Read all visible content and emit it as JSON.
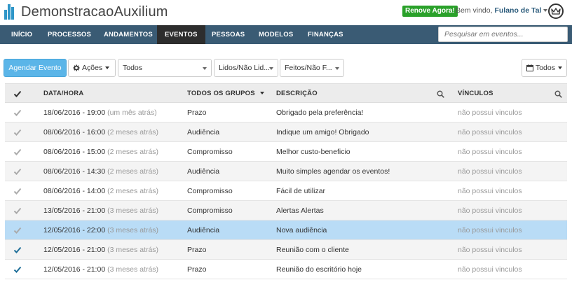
{
  "app": {
    "title": "DemonstracaoAuxilium",
    "renew_label": "Renove Agora!",
    "welcome_prefix": "Bem vindo,",
    "user_name": "Fulano de Tal",
    "brand_color": "#2f96c8",
    "nav_color": "#3a5b74"
  },
  "nav": {
    "items": [
      {
        "label": "INÍCIO"
      },
      {
        "label": "PROCESSOS"
      },
      {
        "label": "ANDAMENTOS"
      },
      {
        "label": "EVENTOS"
      },
      {
        "label": "PESSOAS"
      },
      {
        "label": "MODELOS"
      },
      {
        "label": "FINANÇAS"
      }
    ],
    "active_index": 3,
    "search_placeholder": "Pesquisar em eventos..."
  },
  "toolbar": {
    "schedule_label": "Agendar Evento",
    "actions_label": "Ações",
    "filter_all": "Todos",
    "filter_read": "Lidos/Não Lid...",
    "filter_done": "Feitos/Não F...",
    "calendar_filter": "Todos"
  },
  "table": {
    "headers": {
      "datetime": "DATA/HORA",
      "groups": "TODOS OS GRUPOS",
      "description": "DESCRIÇÃO",
      "links": "VÍNCULOS"
    },
    "rows": [
      {
        "date": "18/06/2016 - 19:00",
        "rel": "(um mês atrás)",
        "group": "Prazo",
        "desc": "Obrigado pela preferência!",
        "links": "não possui vinculos",
        "done": false
      },
      {
        "date": "08/06/2016 - 16:00",
        "rel": "(2 meses atrás)",
        "group": "Audiência",
        "desc": "Indique um amigo! Obrigado",
        "links": "não possui vinculos",
        "done": false
      },
      {
        "date": "08/06/2016 - 15:00",
        "rel": "(2 meses atrás)",
        "group": "Compromisso",
        "desc": "Melhor custo-beneficio",
        "links": "não possui vinculos",
        "done": false
      },
      {
        "date": "08/06/2016 - 14:30",
        "rel": "(2 meses atrás)",
        "group": "Audiência",
        "desc": "Muito simples agendar os eventos!",
        "links": "não possui vinculos",
        "done": false
      },
      {
        "date": "08/06/2016 - 14:00",
        "rel": "(2 meses atrás)",
        "group": "Compromisso",
        "desc": "Fácil de utilizar",
        "links": "não possui vinculos",
        "done": false
      },
      {
        "date": "13/05/2016 - 21:00",
        "rel": "(3 meses atrás)",
        "group": "Compromisso",
        "desc": "Alertas Alertas",
        "links": "não possui vinculos",
        "done": false
      },
      {
        "date": "12/05/2016 - 22:00",
        "rel": "(3 meses atrás)",
        "group": "Audiência",
        "desc": "Nova audiência",
        "links": "não possui vinculos",
        "done": false,
        "selected": true
      },
      {
        "date": "12/05/2016 - 21:00",
        "rel": "(3 meses atrás)",
        "group": "Prazo",
        "desc": "Reunião com o cliente",
        "links": "não possui vinculos",
        "done": true
      },
      {
        "date": "12/05/2016 - 21:00",
        "rel": "(3 meses atrás)",
        "group": "Prazo",
        "desc": "Reunião do escritório hoje",
        "links": "não possui vinculos",
        "done": true
      }
    ],
    "colors": {
      "check_done": "#1f6f99",
      "check_pending": "#aaaaaa",
      "selected_row": "#b9dcf6"
    }
  }
}
